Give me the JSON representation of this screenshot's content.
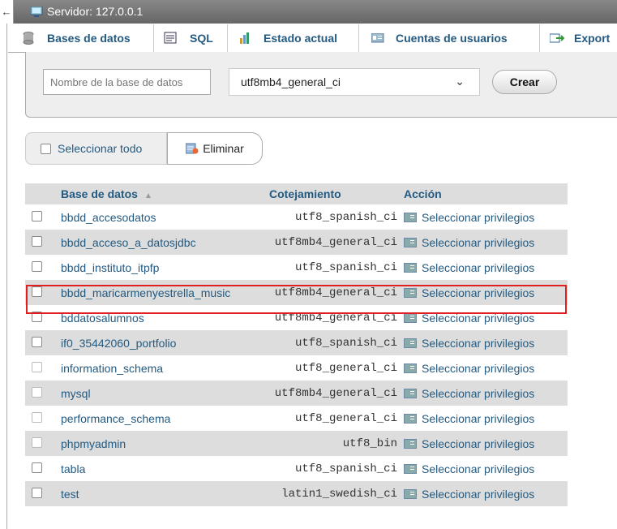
{
  "server": {
    "label": "Servidor: 127.0.0.1"
  },
  "tabs": [
    {
      "label": "Bases de datos",
      "icon": "database-icon"
    },
    {
      "label": "SQL",
      "icon": "sql-icon"
    },
    {
      "label": "Estado actual",
      "icon": "status-icon"
    },
    {
      "label": "Cuentas de usuarios",
      "icon": "users-icon"
    },
    {
      "label": "Export",
      "icon": "export-icon"
    }
  ],
  "create": {
    "name_placeholder": "Nombre de la base de datos",
    "collation_value": "utf8mb4_general_ci",
    "create_label": "Crear"
  },
  "actions": {
    "select_all": "Seleccionar todo",
    "delete": "Eliminar"
  },
  "table": {
    "headers": [
      "Base de datos",
      "Cotejamiento",
      "Acción"
    ],
    "rows": [
      {
        "name": "bbdd_accesodatos",
        "collation": "utf8_spanish_ci",
        "action": "Seleccionar privilegios"
      },
      {
        "name": "bbdd_acceso_a_datosjdbc",
        "collation": "utf8mb4_general_ci",
        "action": "Seleccionar privilegios"
      },
      {
        "name": "bbdd_instituto_itpfp",
        "collation": "utf8_spanish_ci",
        "action": "Seleccionar privilegios"
      },
      {
        "name": "bbdd_maricarmenyestrella_music",
        "collation": "utf8mb4_general_ci",
        "action": "Seleccionar privilegios"
      },
      {
        "name": "bddatosalumnos",
        "collation": "utf8mb4_general_ci",
        "action": "Seleccionar privilegios"
      },
      {
        "name": "if0_35442060_portfolio",
        "collation": "utf8_spanish_ci",
        "action": "Seleccionar privilegios"
      },
      {
        "name": "information_schema",
        "collation": "utf8_general_ci",
        "action": "Seleccionar privilegios"
      },
      {
        "name": "mysql",
        "collation": "utf8mb4_general_ci",
        "action": "Seleccionar privilegios"
      },
      {
        "name": "performance_schema",
        "collation": "utf8_general_ci",
        "action": "Seleccionar privilegios"
      },
      {
        "name": "phpmyadmin",
        "collation": "utf8_bin",
        "action": "Seleccionar privilegios"
      },
      {
        "name": "tabla",
        "collation": "utf8_spanish_ci",
        "action": "Seleccionar privilegios"
      },
      {
        "name": "test",
        "collation": "latin1_swedish_ci",
        "action": "Seleccionar privilegios"
      }
    ]
  },
  "colors": {
    "link": "#235a81",
    "highlight": "#e02020",
    "row_alt": "#dddddd"
  }
}
